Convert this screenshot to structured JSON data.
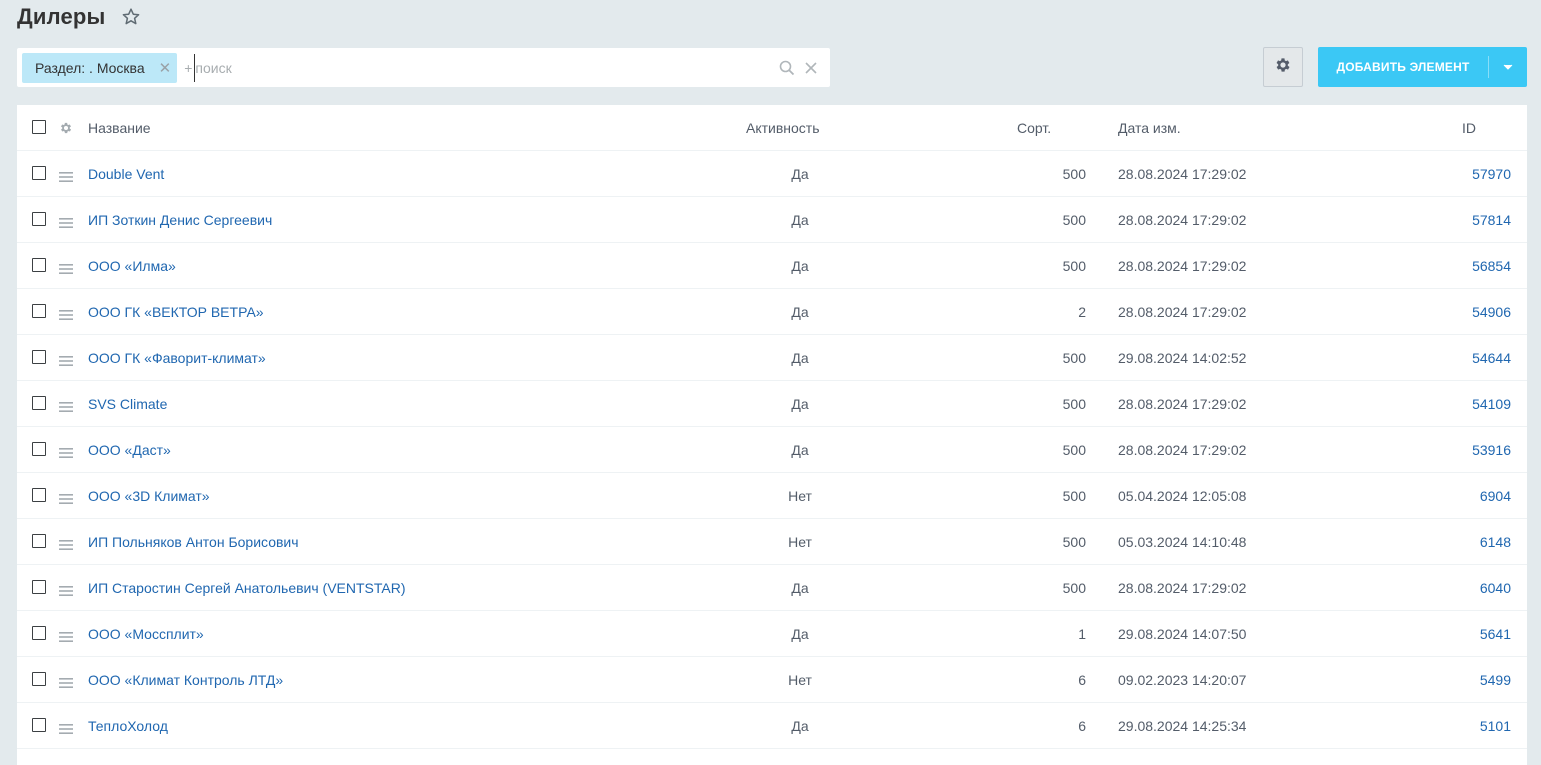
{
  "page": {
    "title": "Дилеры"
  },
  "filter": {
    "tag_label": "Раздел: . Москва",
    "search_prefix": "+",
    "search_placeholder": "поиск"
  },
  "toolbar": {
    "add_label": "Добавить элемент"
  },
  "colors": {
    "accent": "#3bc8f5",
    "link": "#2067b0",
    "filter_tag": "#bce8f8",
    "background": "#e3eaed"
  },
  "table": {
    "columns": {
      "name": "Название",
      "active": "Активность",
      "sort": "Сорт.",
      "date": "Дата изм.",
      "id": "ID"
    },
    "rows": [
      {
        "name": "Double Vent",
        "active": "Да",
        "sort": "500",
        "date": "28.08.2024 17:29:02",
        "id": "57970"
      },
      {
        "name": "ИП Зоткин Денис Сергеевич",
        "active": "Да",
        "sort": "500",
        "date": "28.08.2024 17:29:02",
        "id": "57814"
      },
      {
        "name": "ООО «Илма»",
        "active": "Да",
        "sort": "500",
        "date": "28.08.2024 17:29:02",
        "id": "56854"
      },
      {
        "name": "ООО ГК «ВЕКТОР ВЕТРА»",
        "active": "Да",
        "sort": "2",
        "date": "28.08.2024 17:29:02",
        "id": "54906"
      },
      {
        "name": "ООО ГК «Фаворит-климат»",
        "active": "Да",
        "sort": "500",
        "date": "29.08.2024 14:02:52",
        "id": "54644"
      },
      {
        "name": "SVS Climate",
        "active": "Да",
        "sort": "500",
        "date": "28.08.2024 17:29:02",
        "id": "54109"
      },
      {
        "name": "ООО «Даст»",
        "active": "Да",
        "sort": "500",
        "date": "28.08.2024 17:29:02",
        "id": "53916"
      },
      {
        "name": "ООО «3D Климат»",
        "active": "Нет",
        "sort": "500",
        "date": "05.04.2024 12:05:08",
        "id": "6904"
      },
      {
        "name": "ИП Польняков Антон Борисович",
        "active": "Нет",
        "sort": "500",
        "date": "05.03.2024 14:10:48",
        "id": "6148"
      },
      {
        "name": "ИП Старостин Сергей Анатольевич (VENTSTAR)",
        "active": "Да",
        "sort": "500",
        "date": "28.08.2024 17:29:02",
        "id": "6040"
      },
      {
        "name": "ООО «Мосcплит»",
        "active": "Да",
        "sort": "1",
        "date": "29.08.2024 14:07:50",
        "id": "5641"
      },
      {
        "name": "ООО «Климат Контроль ЛТД»",
        "active": "Нет",
        "sort": "6",
        "date": "09.02.2023 14:20:07",
        "id": "5499"
      },
      {
        "name": "ТеплоХолод",
        "active": "Да",
        "sort": "6",
        "date": "29.08.2024 14:25:34",
        "id": "5101"
      }
    ]
  }
}
